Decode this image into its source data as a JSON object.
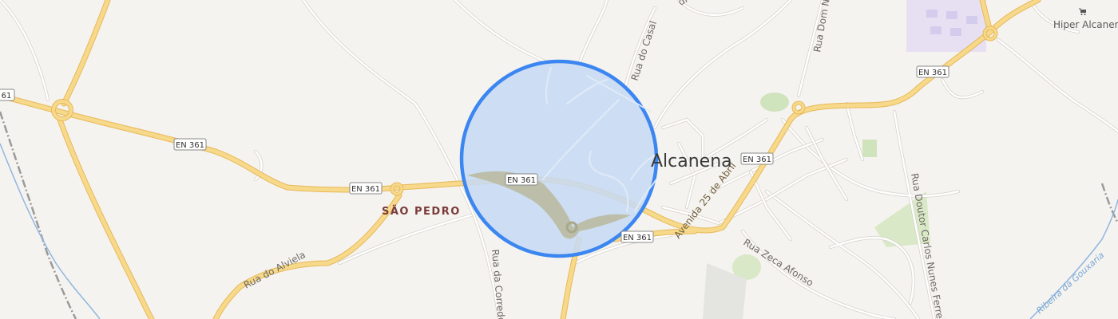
{
  "map": {
    "places": {
      "town": "Alcanena",
      "locality": "SÃO PEDRO",
      "poi": "Hiper Alcanena"
    },
    "road_shields": [
      "EN 361",
      "EN 361",
      "EN 361",
      "EN 361",
      "EN 361",
      "EN 361"
    ],
    "streets": {
      "rua_do_casal": "Rua do Casal",
      "rua_dom": "Rua Dom N",
      "abilio": "dre Abílio Fran",
      "avenida_25_abril": "Avenida 25 de Abril",
      "rua_zeca_afonso": "Rua Zeca Afonso",
      "rua_doutor": "Rua Doutor Carlos Nunes Ferreira",
      "rua_alviela": "Rua do Alviela",
      "rua_corredoura": "Rua da Corredo"
    },
    "waterway": "Ribeira da Gouxaria",
    "colors": {
      "background": "#f5f3ef",
      "major_road": "#f6d98a",
      "major_road_casing": "#e8b85a",
      "minor_road": "#ffffff",
      "minor_road_casing": "#d6d1ca",
      "accuracy_fill": "#c5d9f5",
      "accuracy_stroke": "#3b86f0",
      "green": "#cfe3bd",
      "water": "#8fb6e0",
      "railway": "#9a9a9a"
    }
  }
}
